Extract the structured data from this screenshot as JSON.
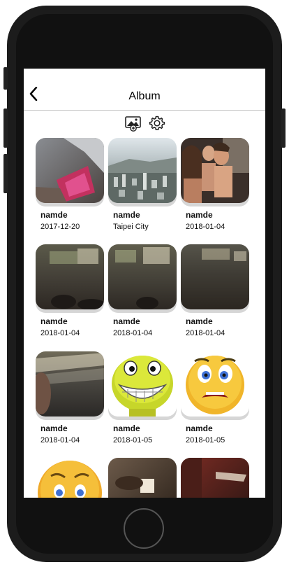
{
  "header": {
    "title": "Album"
  },
  "toolbar": {
    "add_photo_icon": "add-image-icon",
    "settings_icon": "gear-icon"
  },
  "items": [
    {
      "name": "namde",
      "date": "2017-12-20"
    },
    {
      "name": "namde",
      "date": "Taipei City"
    },
    {
      "name": "namde",
      "date": "2018-01-04"
    },
    {
      "name": "namde",
      "date": "2018-01-04"
    },
    {
      "name": "namde",
      "date": "2018-01-04"
    },
    {
      "name": "namde",
      "date": "2018-01-04"
    },
    {
      "name": "namde",
      "date": "2018-01-04"
    },
    {
      "name": "namde",
      "date": "2018-01-05"
    },
    {
      "name": "namde",
      "date": "2018-01-05"
    },
    {
      "name": "",
      "date": ""
    },
    {
      "name": "",
      "date": ""
    },
    {
      "name": "",
      "date": ""
    }
  ]
}
